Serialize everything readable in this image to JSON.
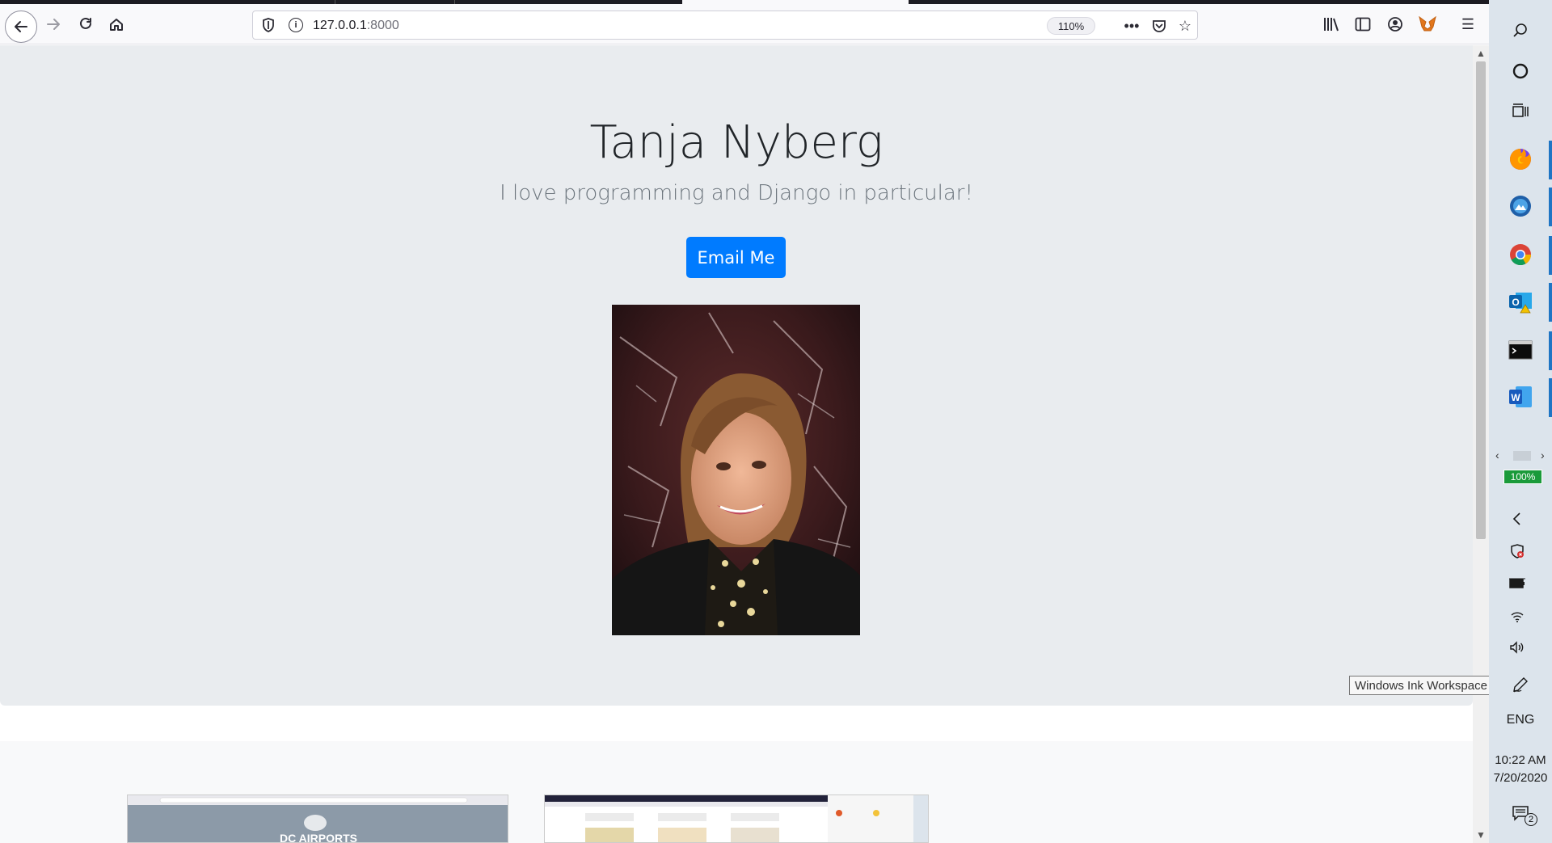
{
  "browser": {
    "url_host": "127.0.0.1",
    "url_port": ":8000",
    "zoom": "110%"
  },
  "hero": {
    "name": "Tanja Nyberg",
    "tagline": "I love programming and Django in particular!",
    "email_button": "Email Me"
  },
  "thumbnails": [
    {
      "caption": "DC AIRPORTS"
    },
    {
      "caption": ""
    }
  ],
  "taskbar": {
    "magnifier_zoom": "100%",
    "tooltip": "Windows Ink Workspace",
    "language": "ENG",
    "time": "10:22 AM",
    "date": "7/20/2020",
    "notification_count": "2"
  },
  "colors": {
    "accent": "#007bff",
    "jumbotron_bg": "#e9ecef",
    "taskbar_bg": "#dce4ec"
  }
}
